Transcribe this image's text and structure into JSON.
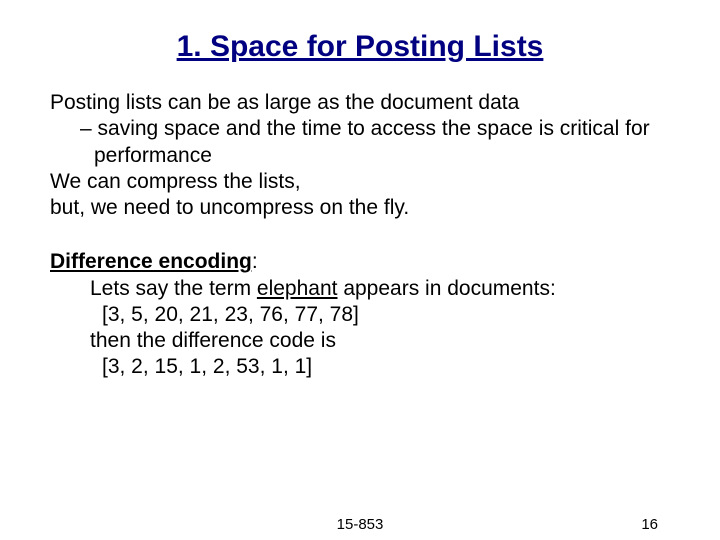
{
  "title": "1. Space for Posting Lists",
  "para1_line1": "Posting lists can be as large as the document data",
  "para1_sub": "saving space and the time to access the space is critical for performance",
  "para1_line2": "We can compress the lists,",
  "para1_line3": "but, we need to uncompress on the fly.",
  "diff_heading": "Difference encoding",
  "diff_colon": ":",
  "diff_line1a": "Lets say the term ",
  "diff_term": "elephant",
  "diff_line1b": " appears in documents:",
  "diff_list1": "[3, 5, 20, 21, 23, 76, 77, 78]",
  "diff_line2": "then the difference code is",
  "diff_list2": "[3, 2, 15,  1,  2,  53,   1,  1]",
  "footer_course": "15-853",
  "footer_page": "16"
}
